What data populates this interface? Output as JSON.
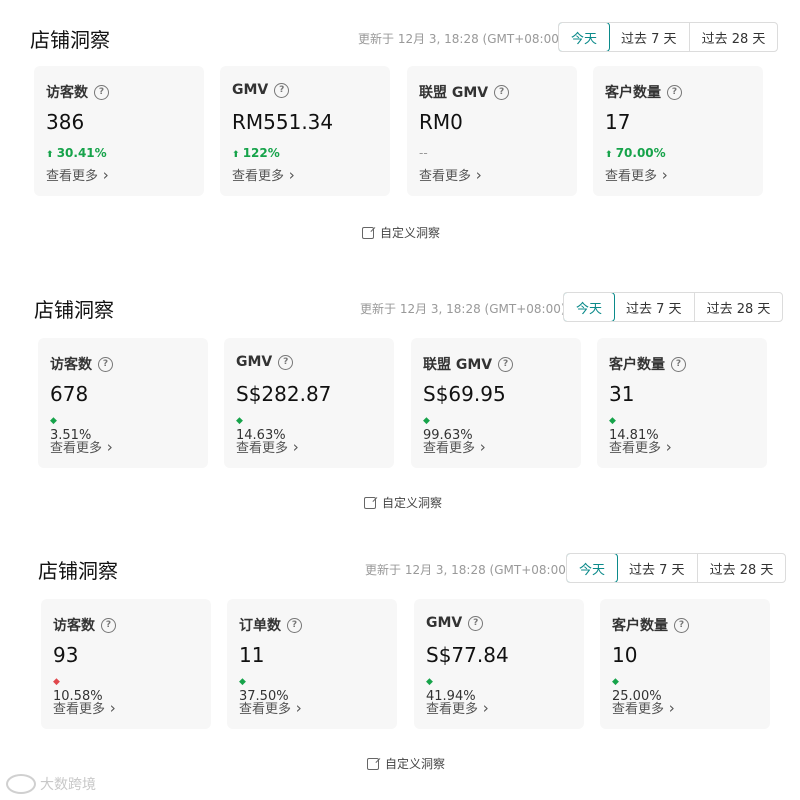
{
  "panels": [
    {
      "title": "店铺洞察",
      "updated": "更新于 12月 3, 18:28 (GMT+08:00)",
      "ranges": [
        "今天",
        "过去 7 天",
        "过去 28 天"
      ],
      "active_range": 0,
      "custom_label": "自定义洞察",
      "cards": [
        {
          "label": "访客数",
          "value": "386",
          "change": "30.41%",
          "dir": "up",
          "more": "查看更多"
        },
        {
          "label": "GMV",
          "value": "RM551.34",
          "change": "122%",
          "dir": "up",
          "more": "查看更多"
        },
        {
          "label": "联盟 GMV",
          "value": "RM0",
          "change": "--",
          "dir": "none",
          "more": "查看更多"
        },
        {
          "label": "客户数量",
          "value": "17",
          "change": "70.00%",
          "dir": "up",
          "more": "查看更多"
        }
      ]
    },
    {
      "title": "店铺洞察",
      "updated": "更新于 12月 3, 18:28 (GMT+08:00)",
      "ranges": [
        "今天",
        "过去 7 天",
        "过去 28 天"
      ],
      "active_range": 0,
      "custom_label": "自定义洞察",
      "cards": [
        {
          "label": "访客数",
          "value": "678",
          "change": "3.51%",
          "dir": "up",
          "more": "查看更多"
        },
        {
          "label": "GMV",
          "value": "S$282.87",
          "change": "14.63%",
          "dir": "up",
          "more": "查看更多"
        },
        {
          "label": "联盟 GMV",
          "value": "S$69.95",
          "change": "99.63%",
          "dir": "up",
          "more": "查看更多"
        },
        {
          "label": "客户数量",
          "value": "31",
          "change": "14.81%",
          "dir": "up",
          "more": "查看更多"
        }
      ]
    },
    {
      "title": "店铺洞察",
      "updated": "更新于 12月 3, 18:28 (GMT+08:00)",
      "ranges": [
        "今天",
        "过去 7 天",
        "过去 28 天"
      ],
      "active_range": 0,
      "custom_label": "自定义洞察",
      "cards": [
        {
          "label": "访客数",
          "value": "93",
          "change": "10.58%",
          "dir": "down",
          "more": "查看更多"
        },
        {
          "label": "订单数",
          "value": "11",
          "change": "37.50%",
          "dir": "up",
          "more": "查看更多"
        },
        {
          "label": "GMV",
          "value": "S$77.84",
          "change": "41.94%",
          "dir": "up",
          "more": "查看更多"
        },
        {
          "label": "客户数量",
          "value": "10",
          "change": "25.00%",
          "dir": "up",
          "more": "查看更多"
        }
      ]
    }
  ],
  "watermark": "大数跨境",
  "colors": {
    "accent": "#0b8a8a",
    "up": "#16a34a",
    "down": "#e0474c"
  }
}
